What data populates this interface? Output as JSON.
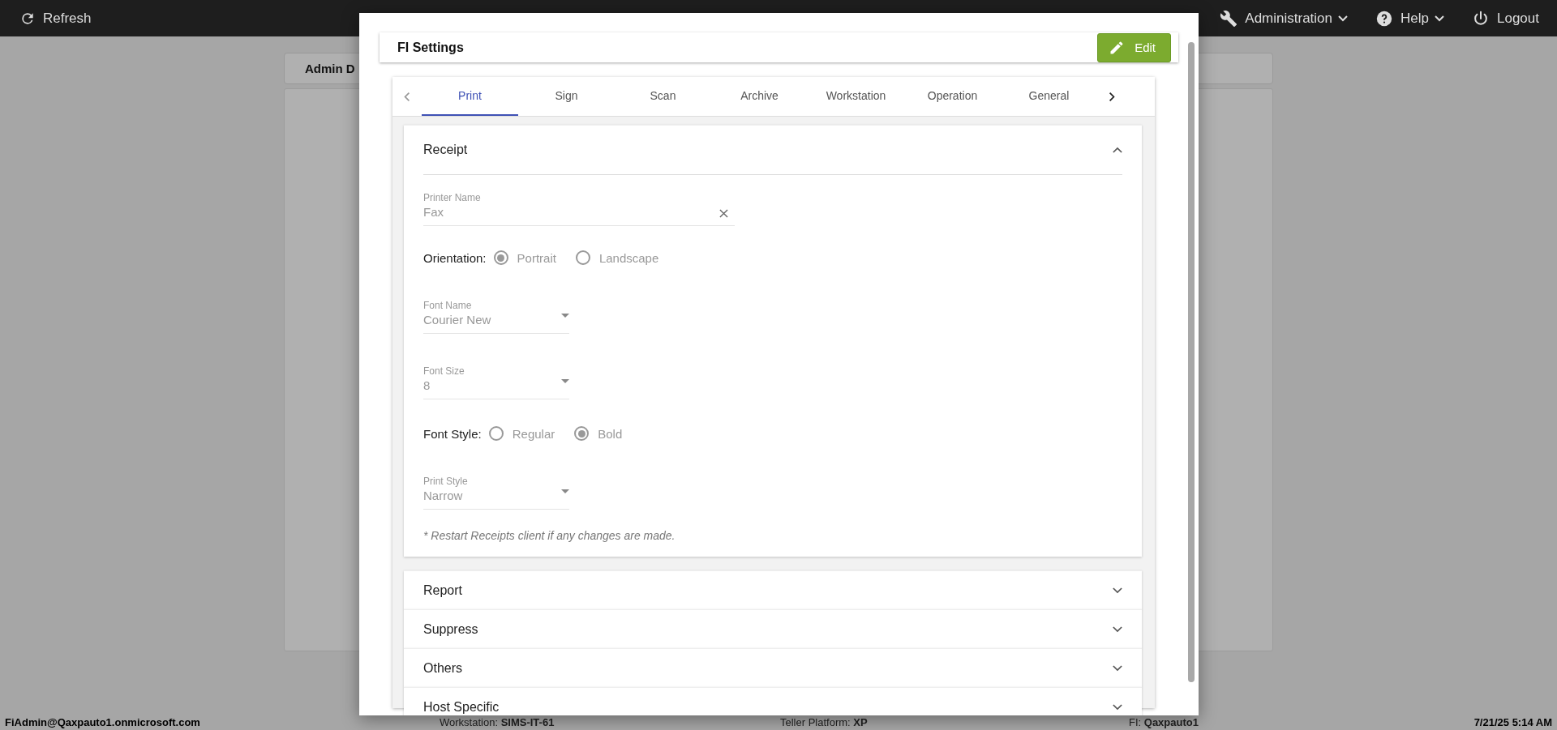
{
  "top_bar": {
    "refresh": "Refresh",
    "menus": [
      {
        "kind": "wrench",
        "label": "Administration",
        "has_menu": true
      },
      {
        "kind": "help",
        "label": "Help",
        "has_menu": true
      },
      {
        "kind": "power",
        "label": "Logout",
        "has_menu": false
      }
    ]
  },
  "background": {
    "card_title": "Admin D"
  },
  "modal": {
    "title": "FI Settings",
    "edit_button": "Edit",
    "tab_nav": {
      "left_disabled": true,
      "right_disabled": false
    },
    "tabs": [
      {
        "label": "Print",
        "selected": true
      },
      {
        "label": "Sign",
        "selected": false
      },
      {
        "label": "Scan",
        "selected": false
      },
      {
        "label": "Archive",
        "selected": false
      },
      {
        "label": "Workstation",
        "selected": false
      },
      {
        "label": "Operation",
        "selected": false
      },
      {
        "label": "General",
        "selected": false
      }
    ],
    "panels": [
      {
        "title": "Receipt",
        "expanded": true,
        "fields": [
          {
            "kind": "text",
            "label": "Printer Name",
            "value": "Fax",
            "clearable": true
          },
          {
            "kind": "radio",
            "label": "Orientation:",
            "options": [
              {
                "label": "Portrait",
                "selected": true
              },
              {
                "label": "Landscape",
                "selected": false
              }
            ]
          },
          {
            "kind": "select",
            "label": "Font Name",
            "value": "Courier New"
          },
          {
            "kind": "select",
            "label": "Font Size",
            "value": "8"
          },
          {
            "kind": "radio",
            "label": "Font Style:",
            "options": [
              {
                "label": "Regular",
                "selected": false
              },
              {
                "label": "Bold",
                "selected": true
              }
            ]
          },
          {
            "kind": "select",
            "label": "Print Style",
            "value": "Narrow"
          },
          {
            "kind": "note",
            "text": "* Restart Receipts client if any changes are made."
          }
        ]
      },
      {
        "title": "Report",
        "expanded": false
      },
      {
        "title": "Suppress",
        "expanded": false
      },
      {
        "title": "Others",
        "expanded": false
      },
      {
        "title": "Host Specific",
        "expanded": false
      }
    ]
  },
  "status_bar": {
    "user": "FiAdmin@Qaxpauto1.onmicrosoft.com",
    "items": [
      {
        "label": "Workstation:",
        "value": "SIMS-IT-61"
      },
      {
        "label": "Teller Platform:",
        "value": "XP"
      },
      {
        "label": "FI:",
        "value": "Qaxpauto1"
      }
    ],
    "datetime": "7/21/25 5:14 AM"
  }
}
